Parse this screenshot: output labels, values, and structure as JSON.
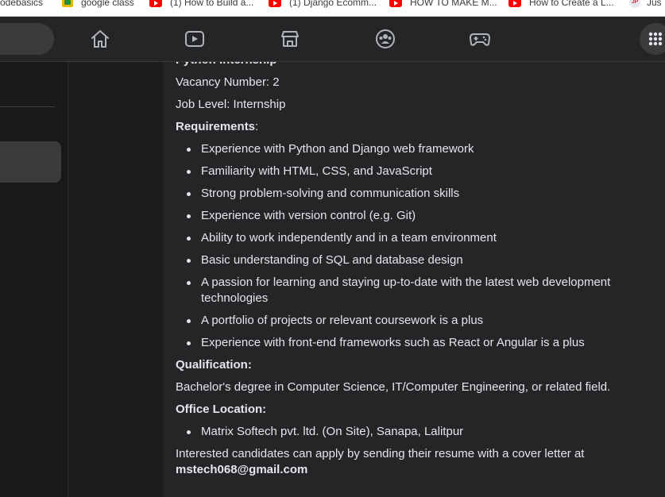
{
  "bookmarks": [
    {
      "label": "codebasics",
      "icon": "bookmark-icon"
    },
    {
      "label": "google class",
      "icon": "google-classroom-icon"
    },
    {
      "label": "(1) How to Build a...",
      "icon": "youtube-icon"
    },
    {
      "label": "(1) Django Ecomm...",
      "icon": "youtube-icon"
    },
    {
      "label": "HOW TO MAKE M...",
      "icon": "youtube-icon"
    },
    {
      "label": "How to Create a L...",
      "icon": "youtube-icon"
    },
    {
      "label": "Jus",
      "icon": "profile-icon"
    }
  ],
  "nav": {
    "icons": [
      "home-icon",
      "watch-icon",
      "marketplace-icon",
      "groups-icon",
      "gaming-icon"
    ],
    "apps_icon": "menu-grid-icon"
  },
  "post": {
    "title": "Python Internship",
    "vacancy": "Vacancy Number: 2",
    "job_level": "Job Level: Internship",
    "requirements_label": "Requirements",
    "requirements_colon": ":",
    "requirements": [
      "Experience with Python and Django web framework",
      "Familiarity with HTML, CSS, and JavaScript",
      "Strong problem-solving and communication skills",
      "Experience with version control (e.g. Git)",
      "Ability to work independently and in a team environment",
      "Basic understanding of SQL and database design",
      "A passion for learning and staying up-to-date with the latest web development technologies",
      "A portfolio of projects or relevant coursework is a plus",
      "Experience with front-end frameworks such as React or Angular is a plus"
    ],
    "qualification_label": "Qualification:",
    "qualification": "Bachelor's degree in Computer Science, IT/Computer Engineering, or related field.",
    "office_label": "Office Location:",
    "office": [
      "Matrix Softech pvt. ltd. (On Site), Sanapa, Lalitpur"
    ],
    "apply_text": "Interested candidates can apply by sending their resume with a cover letter at",
    "email": "mstech068@gmail.com"
  },
  "colors": {
    "background": "#18191a",
    "card": "#242526",
    "text": "#e4e6eb",
    "hover": "#3a3b3c"
  }
}
